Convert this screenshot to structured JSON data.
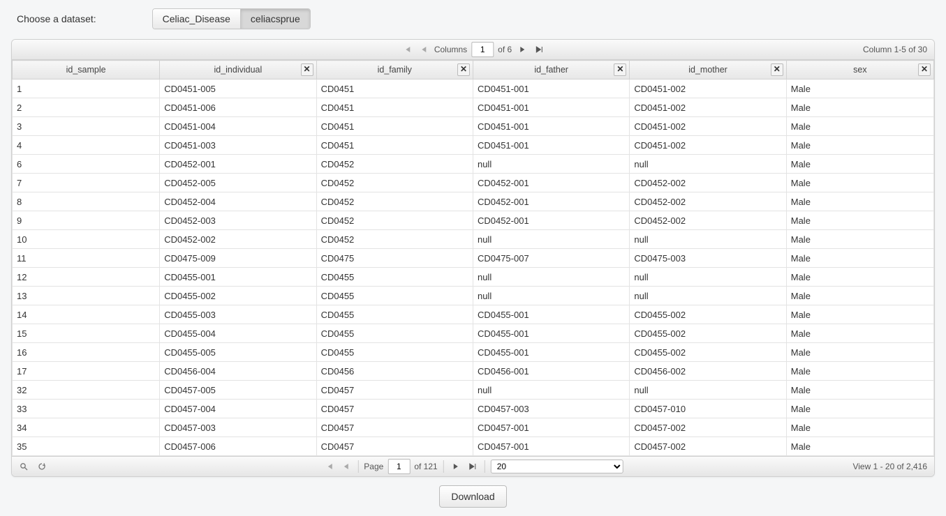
{
  "chooser": {
    "label": "Choose a dataset:",
    "options": [
      "Celiac_Disease",
      "celiacsprue"
    ],
    "active_index": 1
  },
  "top_pager": {
    "columns_label": "Columns",
    "page": "1",
    "of_label": "of 6",
    "summary": "Column 1-5 of 30"
  },
  "columns": [
    {
      "label": "id_sample",
      "closeable": false
    },
    {
      "label": "id_individual",
      "closeable": true
    },
    {
      "label": "id_family",
      "closeable": true
    },
    {
      "label": "id_father",
      "closeable": true
    },
    {
      "label": "id_mother",
      "closeable": true
    },
    {
      "label": "sex",
      "closeable": true
    }
  ],
  "rows": [
    [
      "1",
      "CD0451-005",
      "CD0451",
      "CD0451-001",
      "CD0451-002",
      "Male"
    ],
    [
      "2",
      "CD0451-006",
      "CD0451",
      "CD0451-001",
      "CD0451-002",
      "Male"
    ],
    [
      "3",
      "CD0451-004",
      "CD0451",
      "CD0451-001",
      "CD0451-002",
      "Male"
    ],
    [
      "4",
      "CD0451-003",
      "CD0451",
      "CD0451-001",
      "CD0451-002",
      "Male"
    ],
    [
      "6",
      "CD0452-001",
      "CD0452",
      "null",
      "null",
      "Male"
    ],
    [
      "7",
      "CD0452-005",
      "CD0452",
      "CD0452-001",
      "CD0452-002",
      "Male"
    ],
    [
      "8",
      "CD0452-004",
      "CD0452",
      "CD0452-001",
      "CD0452-002",
      "Male"
    ],
    [
      "9",
      "CD0452-003",
      "CD0452",
      "CD0452-001",
      "CD0452-002",
      "Male"
    ],
    [
      "10",
      "CD0452-002",
      "CD0452",
      "null",
      "null",
      "Male"
    ],
    [
      "11",
      "CD0475-009",
      "CD0475",
      "CD0475-007",
      "CD0475-003",
      "Male"
    ],
    [
      "12",
      "CD0455-001",
      "CD0455",
      "null",
      "null",
      "Male"
    ],
    [
      "13",
      "CD0455-002",
      "CD0455",
      "null",
      "null",
      "Male"
    ],
    [
      "14",
      "CD0455-003",
      "CD0455",
      "CD0455-001",
      "CD0455-002",
      "Male"
    ],
    [
      "15",
      "CD0455-004",
      "CD0455",
      "CD0455-001",
      "CD0455-002",
      "Male"
    ],
    [
      "16",
      "CD0455-005",
      "CD0455",
      "CD0455-001",
      "CD0455-002",
      "Male"
    ],
    [
      "17",
      "CD0456-004",
      "CD0456",
      "CD0456-001",
      "CD0456-002",
      "Male"
    ],
    [
      "32",
      "CD0457-005",
      "CD0457",
      "null",
      "null",
      "Male"
    ],
    [
      "33",
      "CD0457-004",
      "CD0457",
      "CD0457-003",
      "CD0457-010",
      "Male"
    ],
    [
      "34",
      "CD0457-003",
      "CD0457",
      "CD0457-001",
      "CD0457-002",
      "Male"
    ],
    [
      "35",
      "CD0457-006",
      "CD0457",
      "CD0457-001",
      "CD0457-002",
      "Male"
    ]
  ],
  "bottom_pager": {
    "page_label": "Page",
    "page": "1",
    "of_label": "of 121",
    "page_size": "20",
    "summary": "View 1 - 20 of 2,416"
  },
  "download_label": "Download"
}
